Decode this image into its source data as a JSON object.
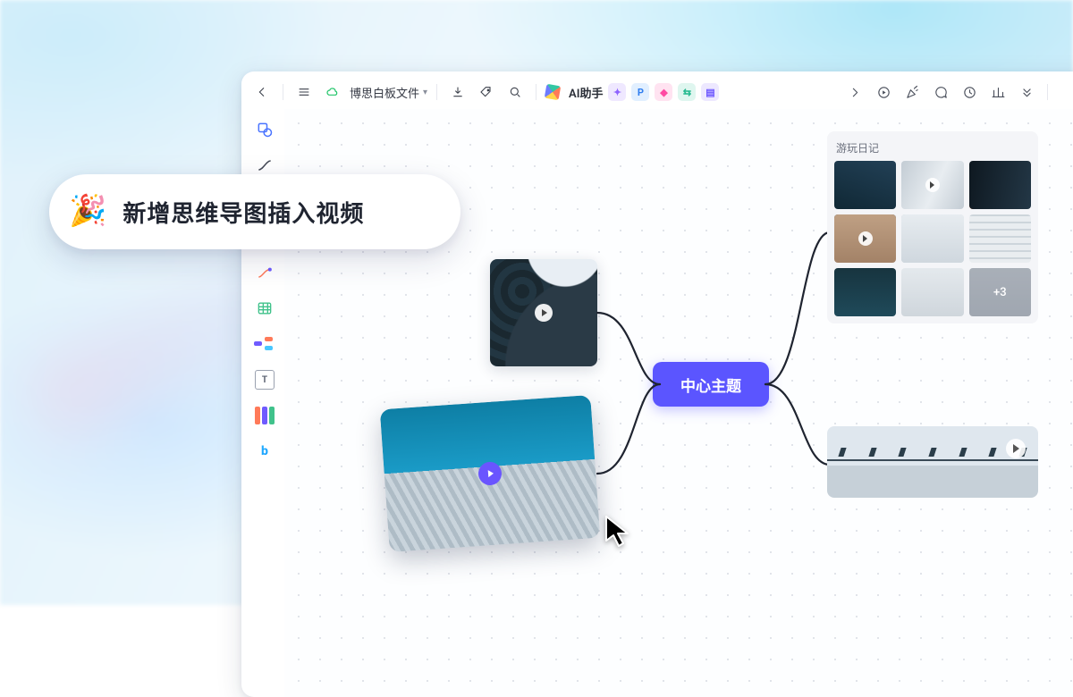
{
  "topbar": {
    "filename": "博思白板文件",
    "ai_label": "AI助手"
  },
  "callout": {
    "emoji": "🎉",
    "text": "新增思维导图插入视频"
  },
  "mindmap": {
    "center_label": "中心主题"
  },
  "gallery": {
    "title": "游玩日记",
    "more_label": "+3"
  },
  "text_tool_glyph": "T"
}
